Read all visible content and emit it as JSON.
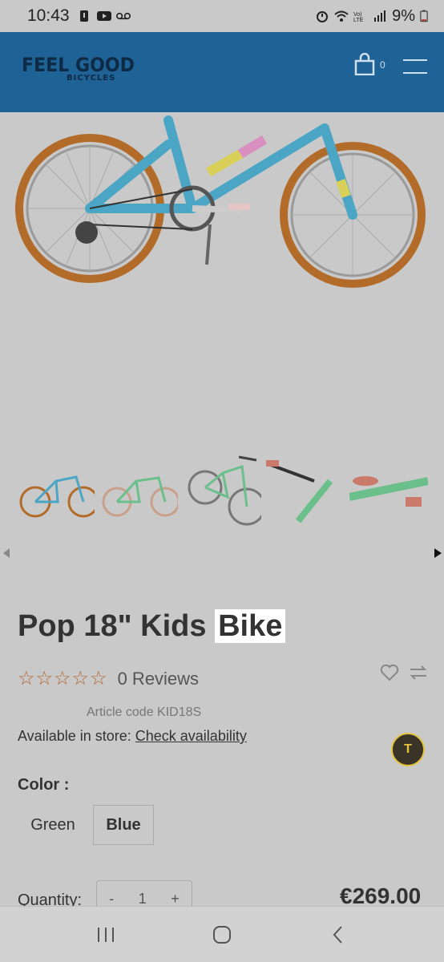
{
  "status_bar": {
    "time": "10:43",
    "battery": "9%"
  },
  "header": {
    "logo_line1": "FEEL GOOD",
    "logo_line2": "BICYCLES",
    "cart_count": "0"
  },
  "product": {
    "title_main": "Pop 18\" Kids",
    "title_highlight": "Bike",
    "stars_filled": 0,
    "stars_total": 5,
    "reviews": "0 Reviews",
    "article_code": "Article code KID18S",
    "availability_label": "Available in store:",
    "availability_link": "Check availability",
    "color_label": "Color :",
    "colors": [
      "Green",
      "Blue"
    ],
    "selected_color": "Blue",
    "quantity_label": "Quantity:",
    "quantity_minus": "-",
    "quantity_value": "1",
    "quantity_plus": "+",
    "price": "€269.00"
  },
  "colors": {
    "header_bg": "#1e6296",
    "page_bg": "#c9c9c9",
    "star": "#b2662e"
  }
}
